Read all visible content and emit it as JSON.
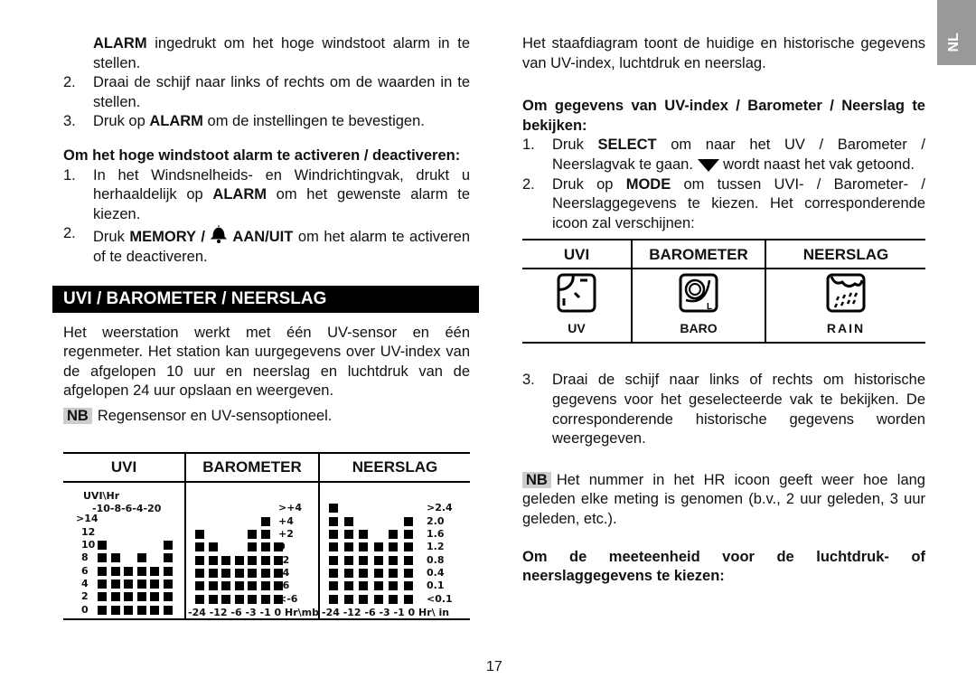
{
  "side_tab": "NL",
  "page_number": "17",
  "left": {
    "p1_bold": "ALARM",
    "p1": " ingedrukt om het hoge windstoot alarm in te stellen.",
    "step2": "Draai de schijf naar links of rechts om de waarden in te stellen.",
    "step3_a": "Druk op ",
    "step3_b": "ALARM",
    "step3_c": " om de instellingen te bevestigen.",
    "heading1": "Om het hoge windstoot alarm te activeren / deactiveren:",
    "s1a": "In het Windsnelheids- en Windrichtingvak, drukt u herhaaldelijk op ",
    "s1b": "ALARM",
    "s1c": " om het gewenste alarm te kiezen.",
    "s2a": "Druk ",
    "s2b": "MEMORY / ",
    "s2c": " AAN/UIT",
    "s2d": " om het alarm te activeren of te deactiveren.",
    "section_title": "UVI / BAROMETER / NEERSLAG",
    "intro": "Het weerstation werkt met één UV-sensor en één regenmeter. Het station kan uurgegevens over UV-index van de afgelopen 10 uur en neerslag en luchtdruk van de afgelopen 24 uur opslaan en weergeven.",
    "nb_label": "NB",
    "nb_text": "Regensensor en UV-sensoptioneel.",
    "table_headers": [
      "UVI",
      "BAROMETER",
      "NEERSLAG"
    ]
  },
  "chart_data": [
    {
      "type": "bar",
      "title": "UVI",
      "axis_title": "UVI\\Hr",
      "x": [
        "-10",
        "-8",
        "-6",
        "-4",
        "-2",
        "0"
      ],
      "y_ticks": [
        "0",
        "2",
        "4",
        "6",
        "8",
        "10",
        "12",
        ">14"
      ],
      "values": [
        10,
        8,
        6,
        8,
        6,
        10
      ]
    },
    {
      "type": "bar",
      "title": "BAROMETER",
      "x": [
        "-24",
        "-12",
        "-6",
        "-3",
        "-1",
        "0"
      ],
      "x_unit": "Hr\\mb",
      "y_ticks": [
        "<-6",
        "-6",
        "-4",
        "-2",
        "0",
        "+2",
        "+4",
        ">+4"
      ],
      "levels": [
        6,
        5,
        4,
        4,
        6,
        7,
        5
      ]
    },
    {
      "type": "bar",
      "title": "NEERSLAG",
      "x": [
        "-24",
        "-12",
        "-6",
        "-3",
        "-1",
        "0"
      ],
      "x_unit": "Hr\\",
      "unit": "in",
      "y_ticks": [
        "<0.1",
        "0.1",
        "0.4",
        "0.8",
        "1.2",
        "1.6",
        "2.0",
        ">2.4"
      ],
      "levels": [
        8,
        7,
        6,
        5,
        6,
        7
      ]
    }
  ],
  "right": {
    "intro": "Het staafdiagram toont de huidige en historische gegevens van UV-index, luchtdruk en neerslag.",
    "heading1": "Om gegevens van UV-index / Barometer / Neerslag te bekijken:",
    "s1a": "Druk ",
    "s1b": "SELECT",
    "s1c": " om naar het UV / Barometer / Neerslagvak te gaan. ",
    "s1d": " wordt naast het vak getoond.",
    "s2a": "Druk op ",
    "s2b": "MODE",
    "s2c": " om tussen UVI- / Barometer- / Neerslaggegevens te kiezen. Het corresponderende icoon zal verschijnen:",
    "table_headers": [
      "UVI",
      "BAROMETER",
      "NEERSLAG"
    ],
    "icon_labels": [
      "UV",
      "BARO",
      "RAIN"
    ],
    "s3": "Draai de schijf naar links of rechts om historische gegevens voor het geselecteerde vak te bekijken. De corresponderende historische gegevens worden weergegeven.",
    "nb_label": "NB",
    "nb_text": "Het nummer in het HR icoon geeft weer hoe lang geleden elke meting is genomen (b.v., 2 uur geleden, 3 uur geleden, etc.).",
    "heading2": "Om de meeteenheid voor de luchtdruk- of neerslaggegevens te kiezen:"
  }
}
